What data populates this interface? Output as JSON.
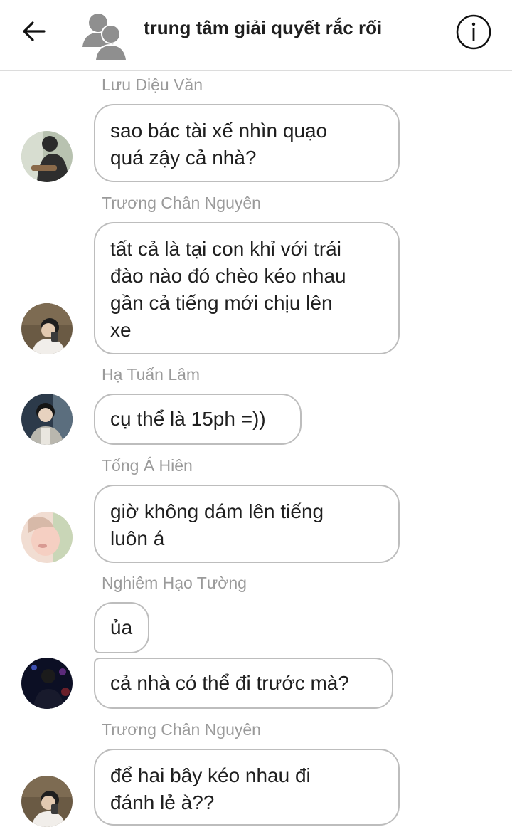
{
  "header": {
    "title": "trung tâm giải quyết rắc rối",
    "back_icon": "arrow-left-icon",
    "group_icon": "group-avatar-icon",
    "info_icon": "info-icon"
  },
  "messages": [
    {
      "sender": "Lưu Diệu Văn",
      "lines": [
        "sao bác tài xế nhìn quạo",
        "quá zậy cả nhà?"
      ]
    },
    {
      "sender": "Trương Chân Nguyên",
      "lines": [
        "tất cả là tại con khỉ với trái",
        "đào nào đó chèo kéo nhau",
        "gần cả tiếng mới chịu lên",
        "xe"
      ]
    },
    {
      "sender": "Hạ Tuấn Lâm",
      "lines": [
        "cụ thể là 15ph =))"
      ]
    },
    {
      "sender": "Tống Á Hiên",
      "lines": [
        "giờ không dám lên tiếng",
        "luôn á"
      ]
    },
    {
      "sender": "Nghiêm Hạo Tường",
      "lines": [
        "ủa"
      ]
    },
    {
      "sender": "Nghiêm Hạo Tường",
      "lines": [
        "cả nhà có thể đi trước mà?"
      ]
    },
    {
      "sender": "Trương Chân Nguyên",
      "lines": [
        "để hai bây kéo nhau đi",
        "đánh lẻ à??"
      ]
    }
  ]
}
